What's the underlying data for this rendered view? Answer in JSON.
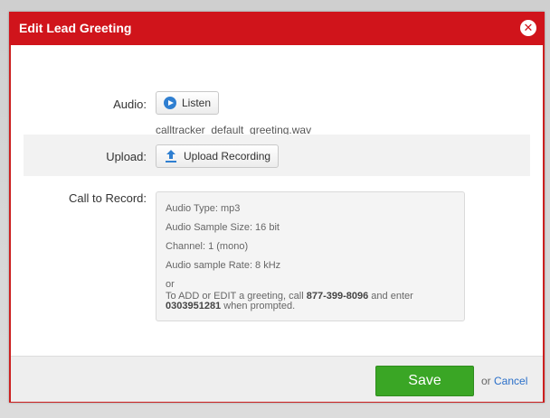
{
  "dialog": {
    "title": "Edit Lead Greeting",
    "close_icon": "close-circle-icon"
  },
  "audio": {
    "label": "Audio:",
    "listen_label": "Listen",
    "listen_icon": "play-icon",
    "filename": "calltracker_default_greeting.wav"
  },
  "upload": {
    "label": "Upload:",
    "button_label": "Upload Recording",
    "button_icon": "upload-icon"
  },
  "call_to_record": {
    "label": "Call to Record:",
    "lines": [
      "Audio Type: mp3",
      "Audio Sample Size: 16 bit",
      "Channel: 1 (mono)",
      "Audio sample Rate: 8 kHz"
    ],
    "or": "or",
    "instruction_prefix": "To ADD or EDIT a greeting, call",
    "phone": "877-399-8096",
    "instruction_middle": "and enter",
    "pin": "0303951281",
    "instruction_suffix": "when prompted."
  },
  "footer": {
    "save_label": "Save",
    "or_text": "or",
    "cancel_label": "Cancel"
  },
  "colors": {
    "header": "#d0141b",
    "save": "#3aa625",
    "link": "#2a6fc9"
  }
}
